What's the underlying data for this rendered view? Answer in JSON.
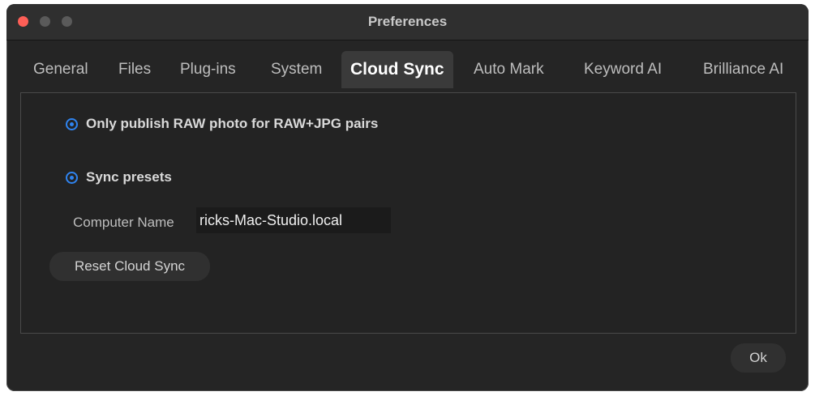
{
  "window": {
    "title": "Preferences"
  },
  "tabs": [
    {
      "label": "General",
      "active": false
    },
    {
      "label": "Files",
      "active": false
    },
    {
      "label": "Plug-ins",
      "active": false
    },
    {
      "label": "System",
      "active": false
    },
    {
      "label": "Cloud Sync",
      "active": true
    },
    {
      "label": "Auto Mark",
      "active": false
    },
    {
      "label": "Keyword AI",
      "active": false
    },
    {
      "label": "Brilliance AI",
      "active": false
    }
  ],
  "cloud_sync": {
    "option_raw": {
      "label": "Only publish RAW photo for RAW+JPG pairs",
      "checked": true
    },
    "option_presets": {
      "label": "Sync presets",
      "checked": true
    },
    "computer_name_label": "Computer Name",
    "computer_name_value": "ricks-Mac-Studio.local",
    "reset_label": "Reset Cloud Sync"
  },
  "footer": {
    "ok_label": "Ok"
  },
  "colors": {
    "accent": "#2f84f0",
    "close": "#fe5f57",
    "window_bg": "#252525"
  }
}
